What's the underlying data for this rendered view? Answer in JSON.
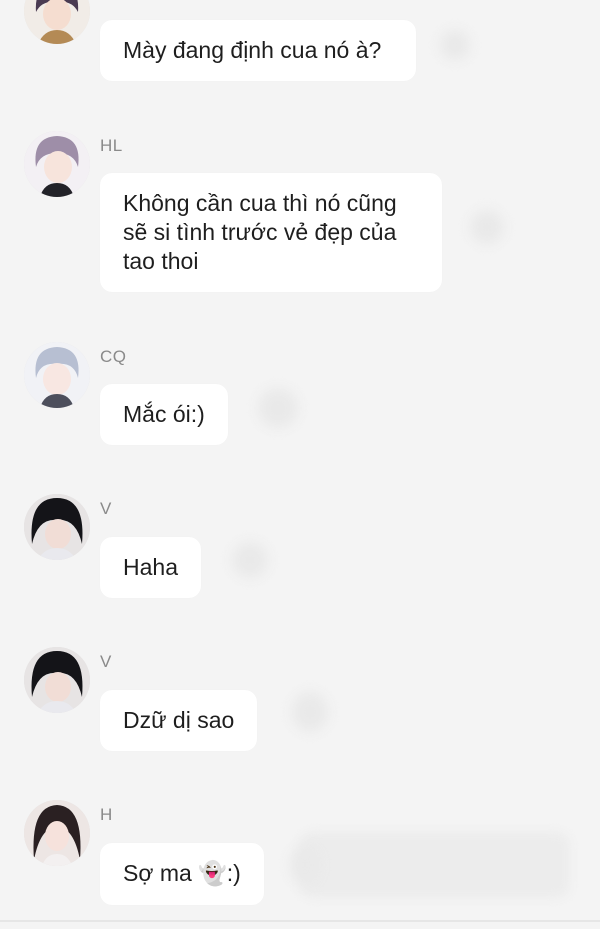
{
  "messages": [
    {
      "sender": "",
      "text": "Mày đang định cua nó à?"
    },
    {
      "sender": "HL",
      "text": "Không cần cua thì nó cũng sẽ si tình trước vẻ đẹp của tao thoi"
    },
    {
      "sender": "CQ",
      "text": "Mắc ói:)"
    },
    {
      "sender": "V",
      "text": "Haha"
    },
    {
      "sender": "V",
      "text": "Dzữ dị sao"
    },
    {
      "sender": "H",
      "text": "Sợ ma",
      "emoji": "👻",
      "suffix": ":)"
    }
  ],
  "colors": {
    "background": "#f4f4f4",
    "bubble": "#ffffff",
    "text": "#1e1e1e",
    "sender_label": "#8a8a8a"
  }
}
